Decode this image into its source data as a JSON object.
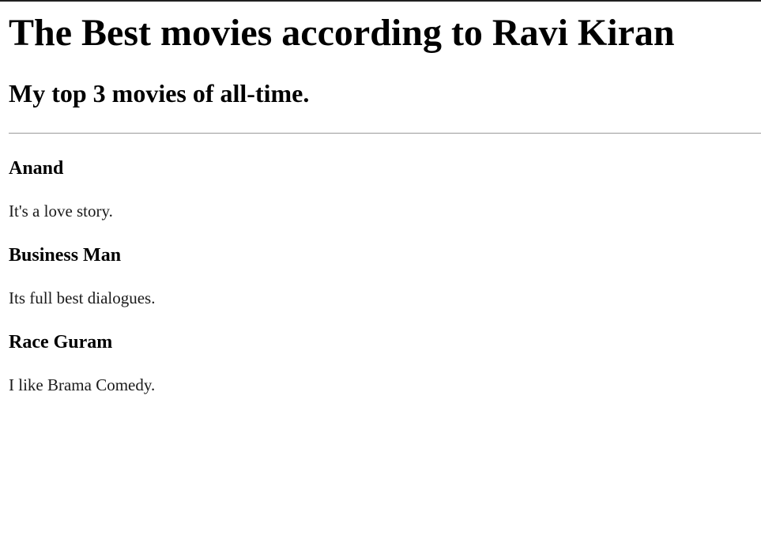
{
  "header": {
    "title": "The Best movies according to Ravi Kiran",
    "subtitle": "My top 3 movies of all-time."
  },
  "movies": [
    {
      "title": "Anand",
      "description": "It's a love story."
    },
    {
      "title": "Business Man",
      "description": "Its full best dialogues."
    },
    {
      "title": "Race Guram",
      "description": "I like Brama Comedy."
    }
  ]
}
